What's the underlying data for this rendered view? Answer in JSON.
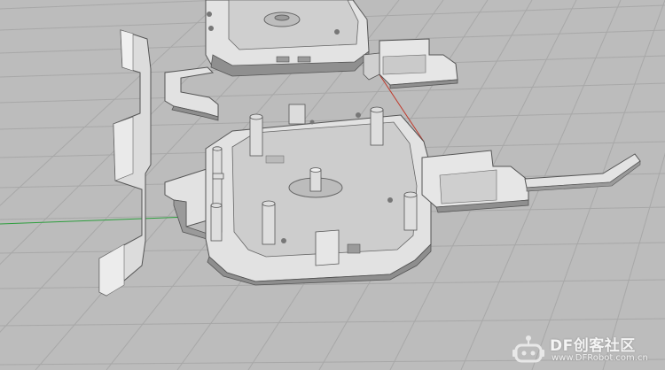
{
  "viewport": {
    "background": "#b9b9b9",
    "grid_color": "#a6a6a6",
    "axis_x_color": "#c0392b",
    "axis_y_color": "#2e9e3e"
  },
  "model_parts": [
    "top-enclosure-shell",
    "top-bracket",
    "top-connector-block",
    "side-panel",
    "bottom-enclosure-base",
    "bottom-bracket",
    "side-connector-block",
    "rod-arm"
  ],
  "watermark": {
    "title": "DF创客社区",
    "url": "www.DFRobot.com.cn",
    "accent": "#e8e8e8"
  }
}
